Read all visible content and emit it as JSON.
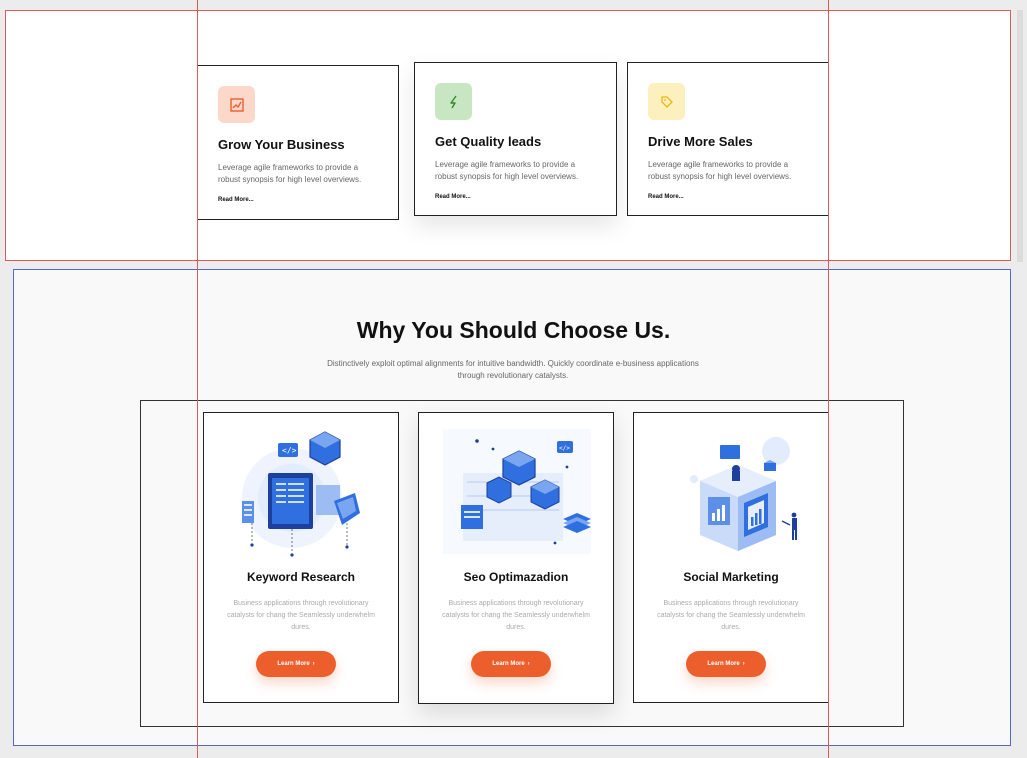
{
  "features": [
    {
      "title": "Grow Your Business",
      "desc": "Leverage agile frameworks to provide a robust synopsis for high level overviews.",
      "link": "Read More...",
      "icon": "chart-line-icon",
      "icon_bg": "#fcd8cb",
      "icon_color": "#ec5f2c"
    },
    {
      "title": "Get Quality leads",
      "desc": "Leverage agile frameworks to provide a robust synopsis for high level overviews.",
      "link": "Read More...",
      "icon": "lightning-icon",
      "icon_bg": "#c9e6c3",
      "icon_color": "#2f8a2f"
    },
    {
      "title": "Drive More Sales",
      "desc": "Leverage agile frameworks to provide a robust synopsis for high level overviews.",
      "link": "Read More...",
      "icon": "tag-icon",
      "icon_bg": "#fdf0bf",
      "icon_color": "#f1b50e"
    }
  ],
  "why": {
    "title": "Why You Should Choose Us.",
    "subtitle": "Distinctively exploit optimal alignments for intuitive bandwidth. Quickly coordinate e-business applications through revolutionary catalysts."
  },
  "services": [
    {
      "title": "Keyword Research",
      "desc": "Business applications through revolutionary catalysts for chang the Seamlessly underwhelm dures.",
      "button": "Learn More",
      "illustration": "keyword-research-illustration"
    },
    {
      "title": "Seo Optimazadion",
      "desc": "Business applications through revolutionary catalysts for chang the Seamlessly underwhelm dures.",
      "button": "Learn More",
      "illustration": "seo-optimization-illustration"
    },
    {
      "title": "Social Marketing",
      "desc": "Business applications through revolutionary catalysts for chang the Seamlessly underwhelm dures.",
      "button": "Learn More",
      "illustration": "social-marketing-illustration"
    }
  ],
  "colors": {
    "accent": "#ec5f2c",
    "illustration_blue": "#2f6fe0",
    "illustration_light": "#dbe7fb"
  }
}
